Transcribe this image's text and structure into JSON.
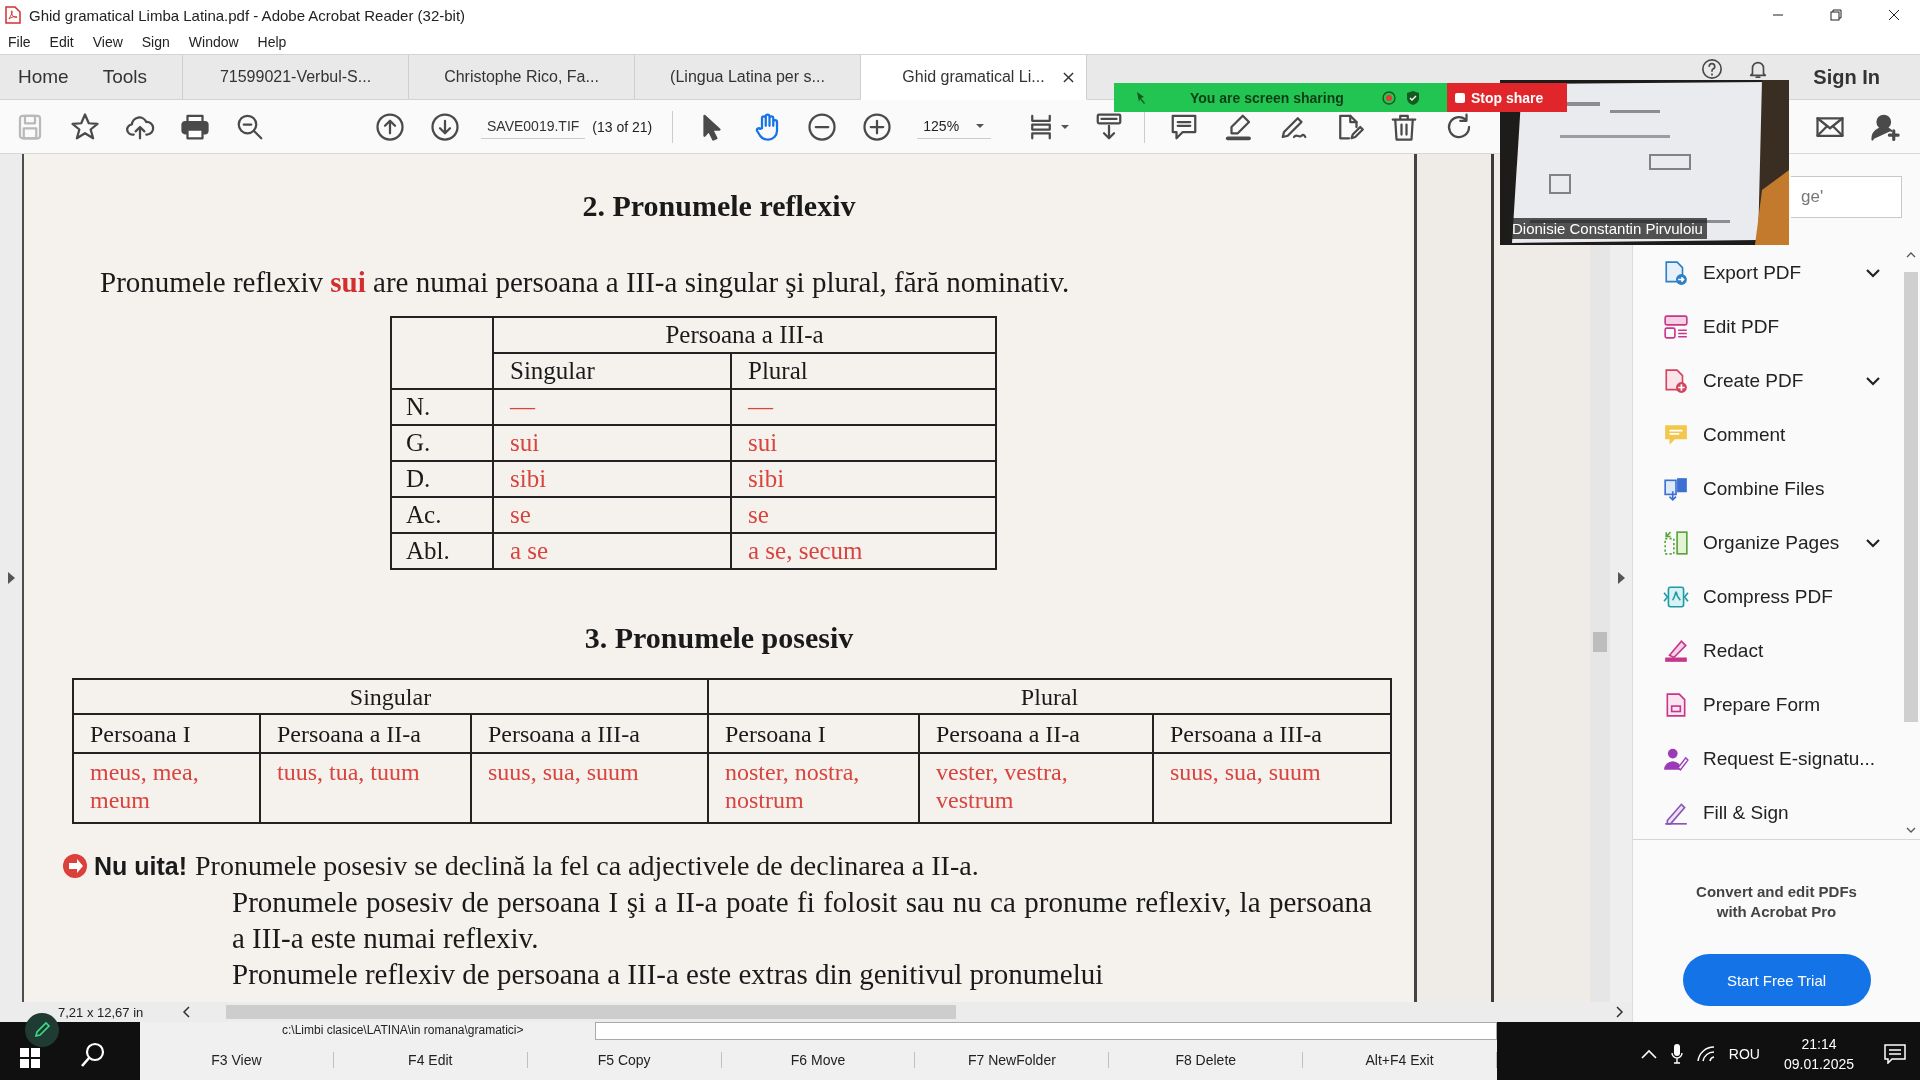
{
  "window": {
    "title": "Ghid gramatical Limba Latina.pdf - Adobe Acrobat Reader (32-bit)"
  },
  "menu": [
    "File",
    "Edit",
    "View",
    "Sign",
    "Window",
    "Help"
  ],
  "nav": [
    "Home",
    "Tools"
  ],
  "tabs": [
    {
      "label": "71599021-Verbul-S...",
      "selected": false
    },
    {
      "label": "Christophe Rico, Fa...",
      "selected": false
    },
    {
      "label": "(Lingua Latina per s...",
      "selected": false
    },
    {
      "label": "Ghid gramatical Li...",
      "selected": true
    }
  ],
  "header_right": {
    "sign_in": "Sign In"
  },
  "toolbar": {
    "file_actions": [
      {
        "kind": "save",
        "disabled": true
      },
      {
        "kind": "star",
        "disabled": false
      },
      {
        "kind": "upload",
        "disabled": false
      },
      {
        "kind": "print",
        "disabled": false
      },
      {
        "kind": "find",
        "disabled": false
      }
    ],
    "page_nav": [
      {
        "kind": "prev"
      },
      {
        "kind": "next"
      }
    ],
    "page_field": "SAVE0019.TIF",
    "page_count": "(13 of 21)",
    "modes": [
      {
        "kind": "select",
        "selected": false
      },
      {
        "kind": "hand",
        "selected": true
      }
    ],
    "zoom_actions": [
      {
        "kind": "zoomout"
      },
      {
        "kind": "zoomin"
      }
    ],
    "zoom": "125%",
    "view_actions": [
      {
        "kind": "fit"
      },
      {
        "kind": "scroll"
      }
    ],
    "edit_actions": [
      {
        "kind": "comment"
      },
      {
        "kind": "highlight"
      },
      {
        "kind": "sign"
      },
      {
        "kind": "edit"
      },
      {
        "kind": "trash"
      },
      {
        "kind": "rotate"
      }
    ],
    "end_actions": [
      {
        "kind": "mail"
      },
      {
        "kind": "account"
      }
    ]
  },
  "screen_share": {
    "status": "You are screen sharing",
    "stop": "Stop share"
  },
  "camera": {
    "kind": "picture",
    "name": "Dionisie Constantin Pirvuloiu"
  },
  "document": {
    "reflexive": {
      "heading": "2. Pronumele reflexiv",
      "intro": "Pronumele reflexiv **sui** are numai persoana a III-a singular şi plural, fără nominativ.",
      "group": "Persoana a III-a",
      "columns": [
        "Singular",
        "Plural"
      ],
      "rows": [
        {
          "case": "N.",
          "forms": [
            "—",
            "—"
          ]
        },
        {
          "case": "G.",
          "forms": [
            "sui",
            "sui"
          ]
        },
        {
          "case": "D.",
          "forms": [
            "sibi",
            "sibi"
          ]
        },
        {
          "case": "Ac.",
          "forms": [
            "se",
            "se"
          ]
        },
        {
          "case": "Abl.",
          "forms": [
            "a se",
            "a se, secum"
          ]
        }
      ]
    },
    "possessive": {
      "heading": "3. Pronumele posesiv",
      "groups": [
        "Singular",
        "Plural"
      ],
      "columns": [
        "Persoana I",
        "Persoana a II-a",
        "Persoana a III-a",
        "Persoana I",
        "Persoana a II-a",
        "Persoana a III-a"
      ],
      "forms": [
        "meus, mea, meum",
        "tuus, tua, tuum",
        "suus, sua, suum",
        "noster, nostra, nostrum",
        "vester, vestra, vestrum",
        "suus, sua, suum"
      ]
    },
    "note": {
      "label": "Nu uita!",
      "text": "Pronumele posesiv se declină la fel ca adjectivele de declinarea a II-a.",
      "paragraphs": [
        "Pronumele posesiv de persoana I şi a II-a poate fi folosit sau nu ca pronume reflexiv, la persoana a III-a este numai reflexiv.",
        "Pronumele reflexiv de persoana a III-a este extras din genitivul pronumelui"
      ]
    }
  },
  "tools_panel": {
    "search_value": "ge'",
    "items": [
      {
        "label": "Export PDF",
        "kind": "export",
        "expandable": true
      },
      {
        "label": "Edit PDF",
        "kind": "editpdf",
        "expandable": false
      },
      {
        "label": "Create PDF",
        "kind": "create",
        "expandable": true
      },
      {
        "label": "Comment",
        "kind": "comment",
        "expandable": false
      },
      {
        "label": "Combine Files",
        "kind": "combine",
        "expandable": false
      },
      {
        "label": "Organize Pages",
        "kind": "organize",
        "expandable": true
      },
      {
        "label": "Compress PDF",
        "kind": "compress",
        "expandable": false
      },
      {
        "label": "Redact",
        "kind": "redact",
        "expandable": false
      },
      {
        "label": "Prepare Form",
        "kind": "form",
        "expandable": false
      },
      {
        "label": "Request E-signatu...",
        "kind": "request",
        "expandable": false
      },
      {
        "label": "Fill & Sign",
        "kind": "fillsign",
        "expandable": false
      }
    ],
    "promo": "Convert and edit PDFs with Acrobat Pro",
    "cta": "Start Free Trial"
  },
  "status": {
    "page_size": "7,21 x 12,67 in"
  },
  "commander": {
    "path": "c:\\Limbi clasice\\LATINA\\in romana\\gramatici>",
    "keys": [
      "F3 View",
      "F4 Edit",
      "F5 Copy",
      "F6 Move",
      "F7 NewFolder",
      "F8 Delete",
      "Alt+F4 Exit"
    ]
  },
  "taskbar": {
    "language": "ROU",
    "time": "21:14",
    "date": "09.01.2025"
  }
}
